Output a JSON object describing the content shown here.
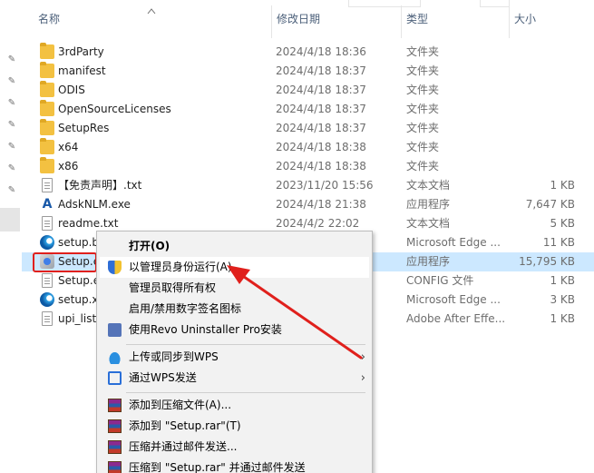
{
  "header": {
    "columns": [
      {
        "label": "名称"
      },
      {
        "label": "修改日期"
      },
      {
        "label": "类型"
      },
      {
        "label": "大小"
      }
    ]
  },
  "files": [
    {
      "name": "3rdParty",
      "date": "2024/4/18 18:36",
      "type": "文件夹",
      "size": "",
      "icon": "folder-icon"
    },
    {
      "name": "manifest",
      "date": "2024/4/18 18:37",
      "type": "文件夹",
      "size": "",
      "icon": "folder-icon"
    },
    {
      "name": "ODIS",
      "date": "2024/4/18 18:37",
      "type": "文件夹",
      "size": "",
      "icon": "folder-icon"
    },
    {
      "name": "OpenSourceLicenses",
      "date": "2024/4/18 18:37",
      "type": "文件夹",
      "size": "",
      "icon": "folder-icon"
    },
    {
      "name": "SetupRes",
      "date": "2024/4/18 18:37",
      "type": "文件夹",
      "size": "",
      "icon": "folder-icon"
    },
    {
      "name": "x64",
      "date": "2024/4/18 18:38",
      "type": "文件夹",
      "size": "",
      "icon": "folder-icon"
    },
    {
      "name": "x86",
      "date": "2024/4/18 18:38",
      "type": "文件夹",
      "size": "",
      "icon": "folder-icon"
    },
    {
      "name": "【免责声明】.txt",
      "date": "2023/11/20 15:56",
      "type": "文本文档",
      "size": "1 KB",
      "icon": "text-file-icon"
    },
    {
      "name": "AdskNLM.exe",
      "date": "2024/4/18 21:38",
      "type": "应用程序",
      "size": "7,647 KB",
      "icon": "autodesk-icon"
    },
    {
      "name": "readme.txt",
      "date": "2024/4/2 22:02",
      "type": "文本文档",
      "size": "5 KB",
      "icon": "text-file-icon"
    },
    {
      "name": "setup.b",
      "date": "",
      "type": "Microsoft Edge ...",
      "size": "11 KB",
      "icon": "edge-icon"
    },
    {
      "name": "Setup.e",
      "date": "",
      "type": "应用程序",
      "size": "15,795 KB",
      "icon": "setup-icon"
    },
    {
      "name": "Setup.e",
      "date": "",
      "type": "CONFIG 文件",
      "size": "1 KB",
      "icon": "text-file-icon"
    },
    {
      "name": "setup.x",
      "date": "",
      "type": "Microsoft Edge ...",
      "size": "3 KB",
      "icon": "edge-icon"
    },
    {
      "name": "upi_list.",
      "date": "",
      "type": "Adobe After Effe...",
      "size": "1 KB",
      "icon": "text-file-icon"
    }
  ],
  "context_menu": {
    "items": [
      {
        "label": "打开(O)",
        "icon": "",
        "arrow": false
      },
      {
        "label": "以管理员身份运行(A)",
        "icon": "shield-icon",
        "arrow": false
      },
      {
        "label": "管理员取得所有权",
        "icon": "",
        "arrow": false
      },
      {
        "label": "启用/禁用数字签名图标",
        "icon": "",
        "arrow": false
      },
      {
        "label": "使用Revo Uninstaller Pro安装",
        "icon": "revo-uninstaller-icon",
        "arrow": false
      },
      {
        "label": "上传或同步到WPS",
        "icon": "wps-cloud-icon",
        "arrow": true
      },
      {
        "label": "通过WPS发送",
        "icon": "wps-share-icon",
        "arrow": true
      },
      {
        "label": "添加到压缩文件(A)...",
        "icon": "winrar-icon",
        "arrow": false
      },
      {
        "label": "添加到 \"Setup.rar\"(T)",
        "icon": "winrar-icon",
        "arrow": false
      },
      {
        "label": "压缩并通过邮件发送...",
        "icon": "winrar-icon",
        "arrow": false
      },
      {
        "label": "压缩到 \"Setup.rar\" 并通过邮件发送",
        "icon": "winrar-icon",
        "arrow": false
      }
    ],
    "arrow_glyph": "›"
  },
  "colors": {
    "selected_row": "#cce8ff",
    "annotation_red": "#e0201c",
    "menu_bg": "#f2f2f2"
  }
}
